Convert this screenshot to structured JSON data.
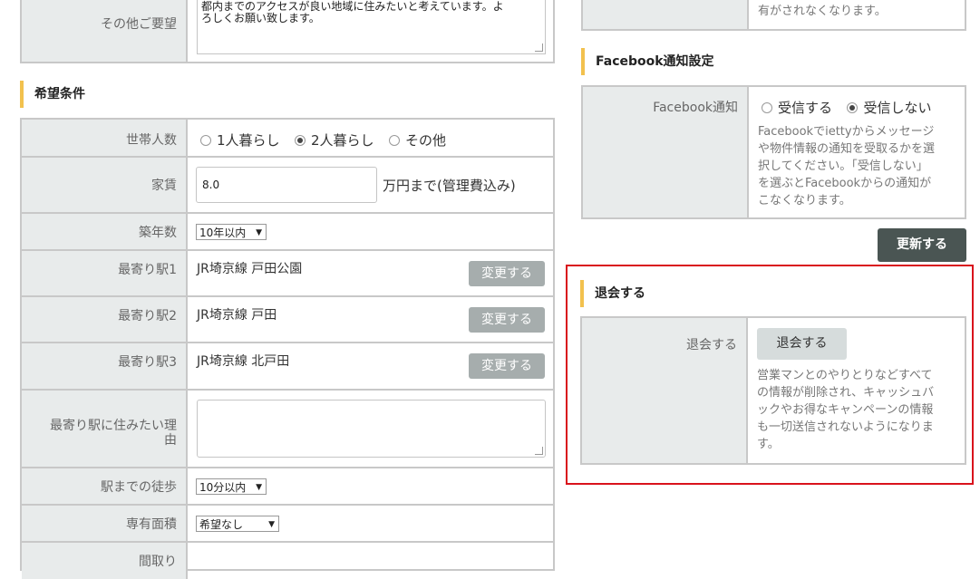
{
  "left": {
    "other_requests": {
      "label": "その他ご要望",
      "text_line1": "都内までのアクセスが良い地域に住みたいと考えています。よ",
      "text_line2": "ろしくお願い致します。"
    },
    "conditions_title": "希望条件",
    "household": {
      "label": "世帯人数",
      "options": [
        "1人暮らし",
        "2人暮らし",
        "その他"
      ],
      "selected": "2人暮らし"
    },
    "rent": {
      "label": "家賃",
      "value": "8.0",
      "suffix": "万円まで(管理費込み)"
    },
    "building_age": {
      "label": "築年数",
      "value": "10年以内"
    },
    "stations": [
      {
        "label": "最寄り駅1",
        "value": "JR埼京線 戸田公園",
        "button": "変更する"
      },
      {
        "label": "最寄り駅2",
        "value": "JR埼京線 戸田",
        "button": "変更する"
      },
      {
        "label": "最寄り駅3",
        "value": "JR埼京線 北戸田",
        "button": "変更する"
      }
    ],
    "reason": {
      "label_line1": "最寄り駅に住みたい理",
      "label_line2": "由"
    },
    "walk": {
      "label": "駅までの徒歩",
      "value": "10分以内"
    },
    "area": {
      "label": "専有面積",
      "value": "希望なし"
    },
    "layout": {
      "label": "間取り"
    }
  },
  "right": {
    "top_helper": "有がされなくなります。",
    "facebook_title": "Facebook通知設定",
    "facebook": {
      "label": "Facebook通知",
      "options": [
        "受信する",
        "受信しない"
      ],
      "selected": "受信しない",
      "help": [
        "Facebookでiettyからメッセージ",
        "や物件情報の通知を受取るかを選",
        "択してください。「受信しない」",
        "を選ぶとFacebookからの通知が",
        "こなくなります。"
      ]
    },
    "update_button": "更新する",
    "withdraw_title": "退会する",
    "withdraw": {
      "label": "退会する",
      "button": "退会する",
      "help": [
        "営業マンとのやりとりなどすべて",
        "の情報が削除され、キャッシュバ",
        "ックやお得なキャンペーンの情報",
        "も一切送信されないようになりま",
        "す。"
      ]
    }
  },
  "colors": {
    "accent_bar": "#f2c14e",
    "label_bg": "#e8ebeb",
    "update_button_bg": "#4a5553",
    "highlight_border": "#d9121c"
  }
}
